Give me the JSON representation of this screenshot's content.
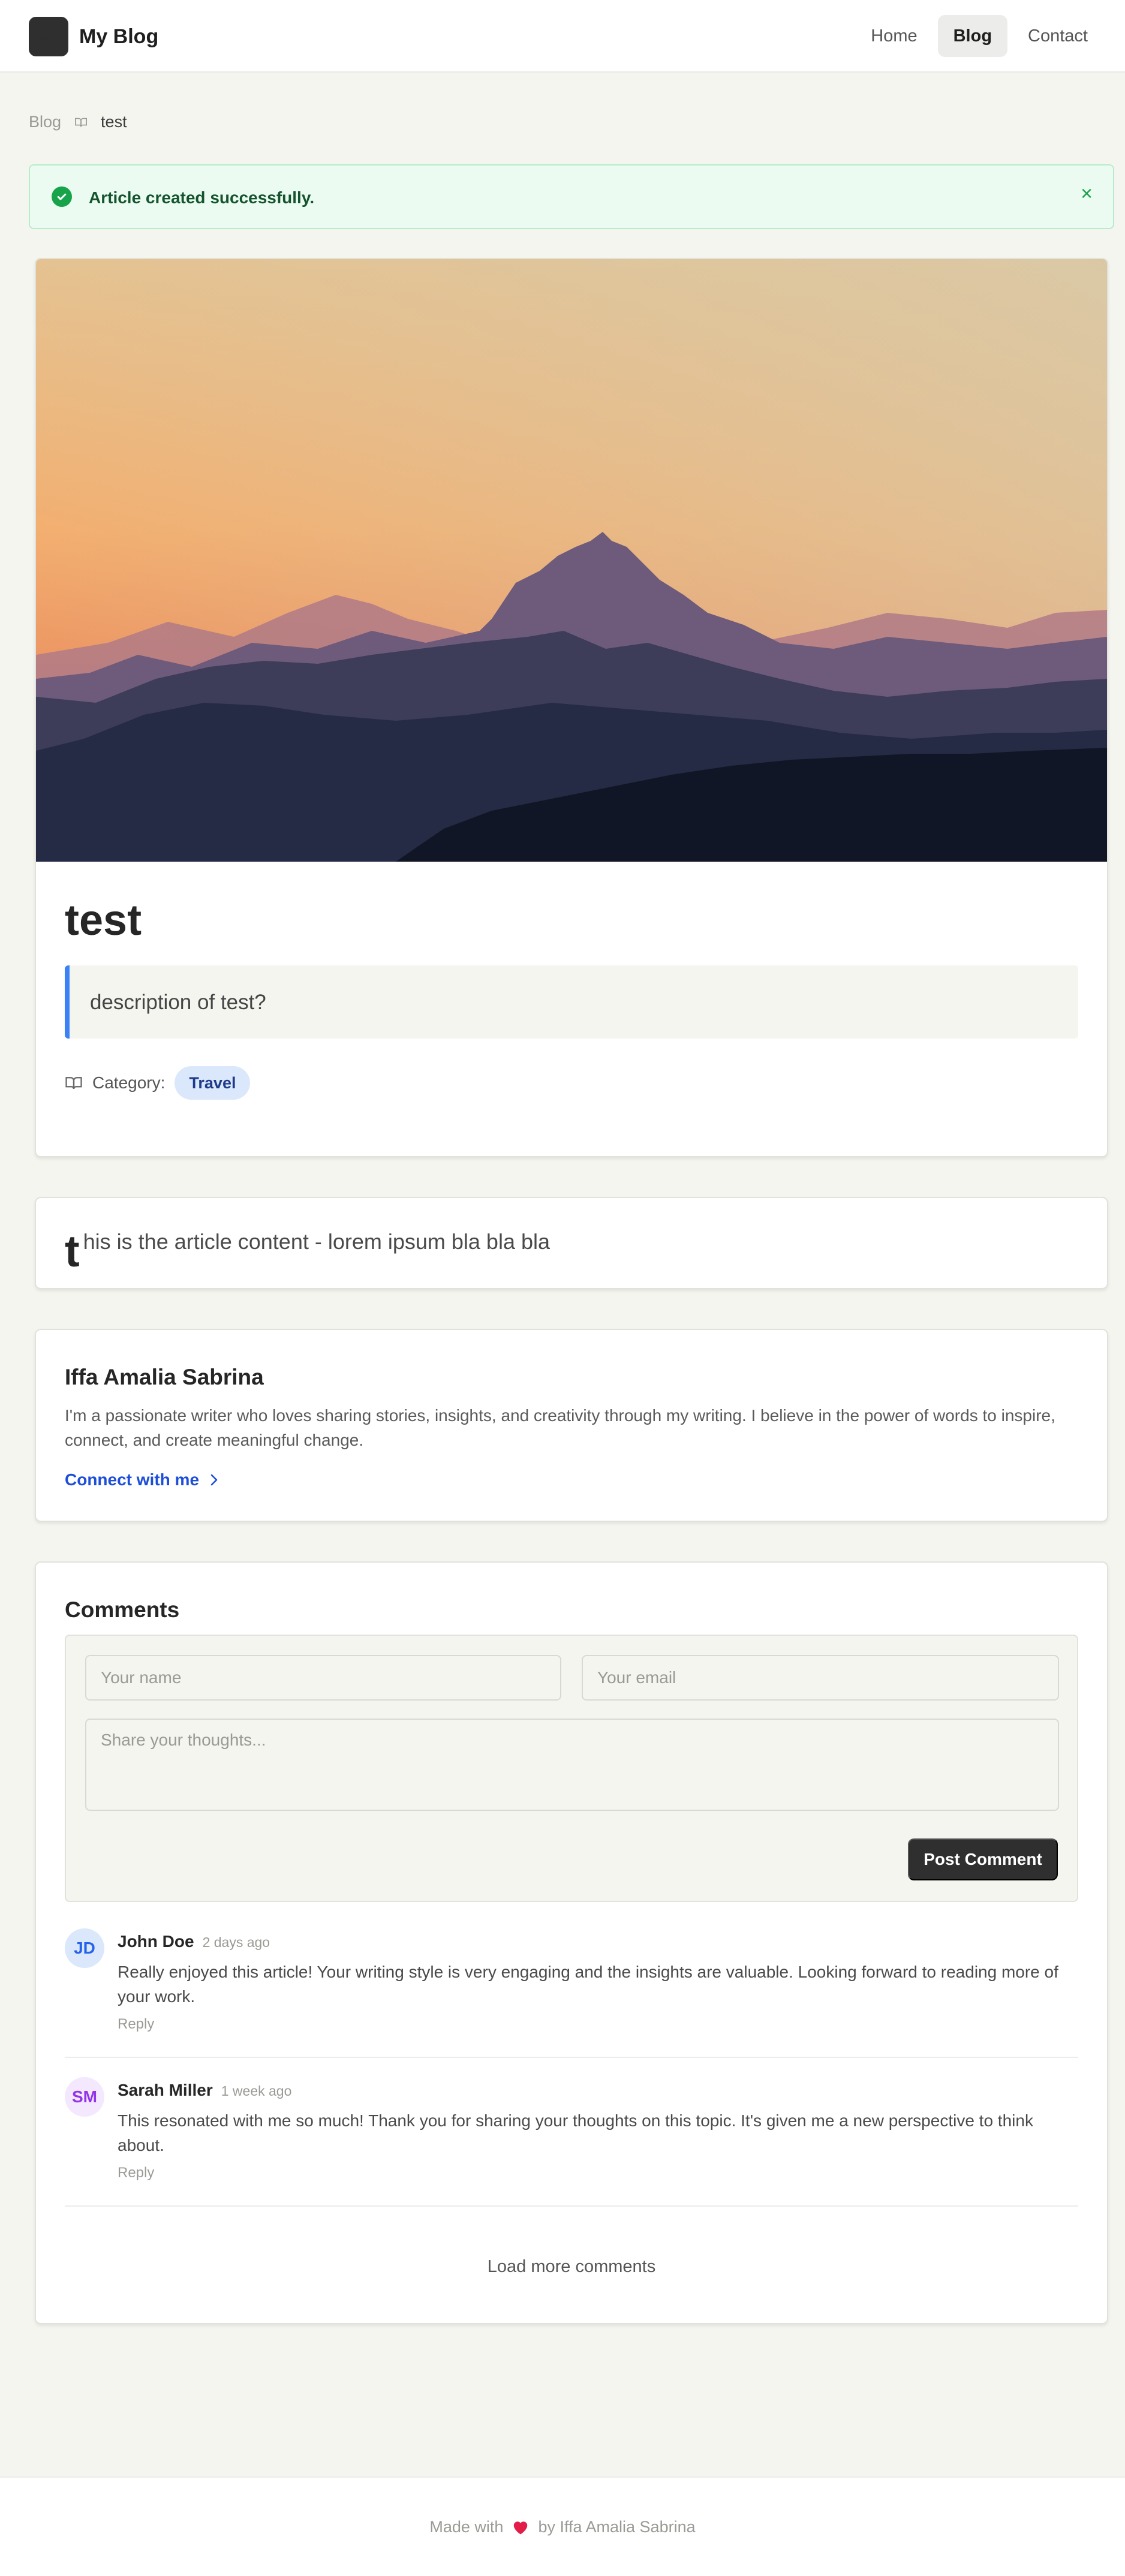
{
  "header": {
    "logo_glyph": "✍",
    "brand": "My Blog",
    "nav": [
      {
        "label": "Home",
        "active": false
      },
      {
        "label": "Blog",
        "active": true
      },
      {
        "label": "Contact",
        "active": false
      }
    ]
  },
  "breadcrumb": {
    "parent": "Blog",
    "current": "test"
  },
  "alert": {
    "message": "Article created successfully.",
    "close": "×",
    "color": "#16a34a"
  },
  "article": {
    "title": "test",
    "description": "description of test?",
    "category_label": "Category:",
    "category": "Travel",
    "content_first_letter": "t",
    "content_rest": "his is the article content - lorem ipsum bla bla bla"
  },
  "author": {
    "name": "Iffa Amalia Sabrina",
    "bio": "I'm a passionate writer who loves sharing stories, insights, and creativity through my writing. I believe in the power of words to inspire, connect, and create meaningful change.",
    "link": "Connect with me"
  },
  "comments": {
    "title": "Comments",
    "form": {
      "name_placeholder": "Your name",
      "email_placeholder": "Your email",
      "text_placeholder": "Share your thoughts...",
      "submit": "Post Comment"
    },
    "items": [
      {
        "initials": "JD",
        "author": "John Doe",
        "time": "2 days ago",
        "body": "Really enjoyed this article! Your writing style is very engaging and the insights are valuable. Looking forward to reading more of your work.",
        "reply": "Reply",
        "avatar_bg": "#dbe8fb",
        "avatar_fg": "#2563eb"
      },
      {
        "initials": "SM",
        "author": "Sarah Miller",
        "time": "1 week ago",
        "body": "This resonated with me so much! Thank you for sharing your thoughts on this topic. It's given me a new perspective to think about.",
        "reply": "Reply",
        "avatar_bg": "#f3e8fd",
        "avatar_fg": "#9333ea"
      }
    ],
    "load_more": "Load more comments"
  },
  "footer": {
    "before": "Made with",
    "after": "by Iffa Amalia Sabrina",
    "heart_color": "#e11d48"
  },
  "colors": {
    "accent": "#3b82f6",
    "link": "#1d4ed8",
    "page_bg": "#f5f5f0"
  },
  "icons": {
    "logo": "writing-hand-icon",
    "breadcrumb_separator": "book-open-icon",
    "alert": "check-circle-icon",
    "category": "book-open-icon",
    "link_arrow": "chevron-right-icon",
    "footer": "heart-icon"
  }
}
